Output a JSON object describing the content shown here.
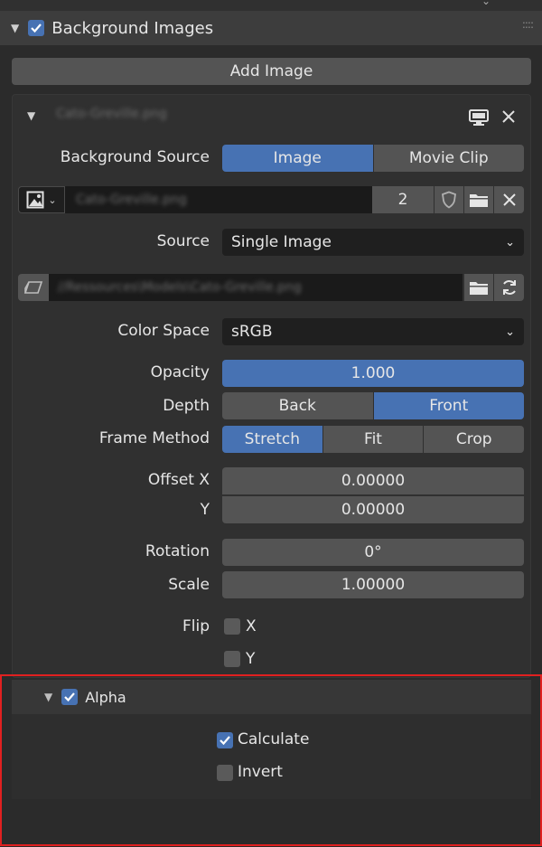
{
  "panel": {
    "title": "Background Images",
    "add_image_label": "Add Image"
  },
  "item": {
    "filename": "Cato-Greville.png",
    "background_source_label": "Background Source",
    "source_options": [
      "Image",
      "Movie Clip"
    ],
    "source_selected": "Image",
    "image_name": "Cato-Greville.png",
    "user_count": "2",
    "source_label": "Source",
    "source_value": "Single Image",
    "filepath": "//Ressources\\Models\\Cato-Greville.png",
    "color_space_label": "Color Space",
    "color_space_value": "sRGB",
    "opacity_label": "Opacity",
    "opacity_value": "1.000",
    "depth_label": "Depth",
    "depth_options": [
      "Back",
      "Front"
    ],
    "depth_selected": "Front",
    "frame_method_label": "Frame Method",
    "frame_method_options": [
      "Stretch",
      "Fit",
      "Crop"
    ],
    "frame_method_selected": "Stretch",
    "offset_x_label": "Offset X",
    "offset_x_value": "0.00000",
    "offset_y_label": "Y",
    "offset_y_value": "0.00000",
    "rotation_label": "Rotation",
    "rotation_value": "0°",
    "scale_label": "Scale",
    "scale_value": "1.00000",
    "flip_label": "Flip",
    "flip_x_label": "X",
    "flip_y_label": "Y",
    "flip_x": false,
    "flip_y": false
  },
  "alpha": {
    "title": "Alpha",
    "enabled": true,
    "calculate_label": "Calculate",
    "calculate": true,
    "invert_label": "Invert",
    "invert": false
  },
  "colors": {
    "accent": "#4772b3",
    "highlight_border": "#e02020"
  }
}
